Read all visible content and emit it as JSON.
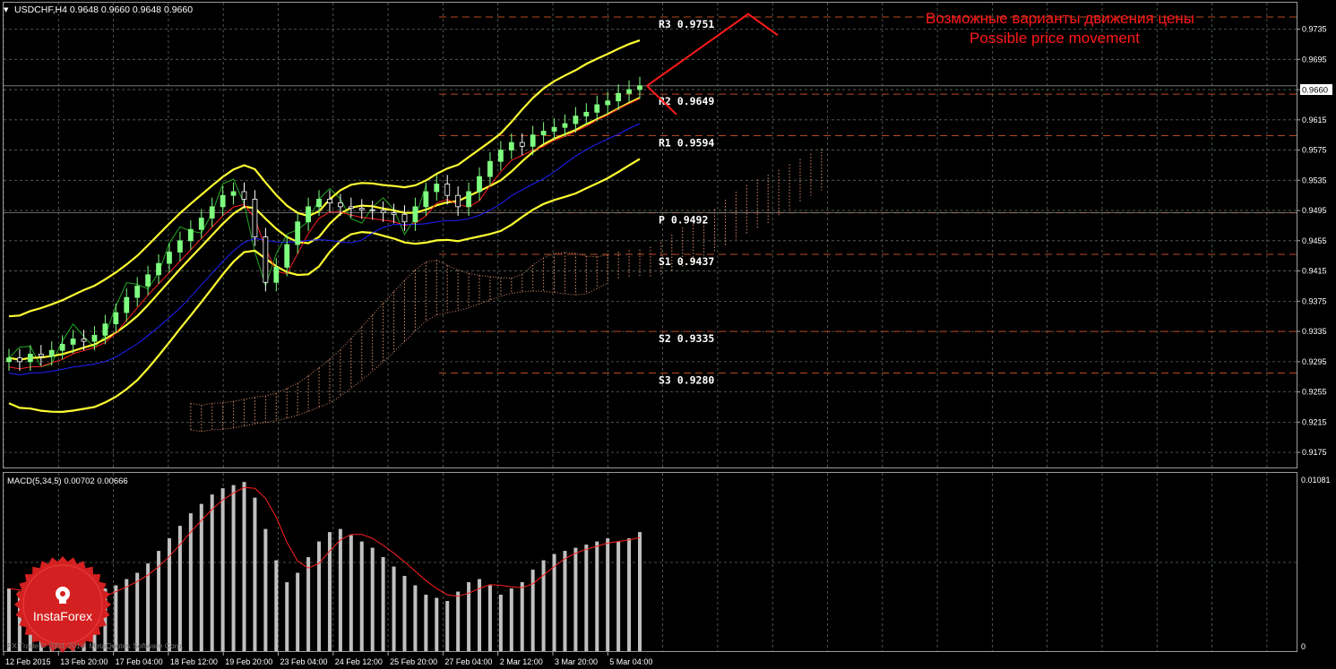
{
  "header": {
    "symbol_info": "USDCHF,H4  0.9648 0.9660 0.9648 0.9660"
  },
  "annotation": {
    "ru": "Возможные варианты движения цены",
    "en": "Possible price movement"
  },
  "brand": {
    "name": "InstaForex",
    "copyright": "FX Trade © 2001-2014, MetaQuotes Software Corp."
  },
  "macd_panel": {
    "label": "MACD(5,34,5) 0.00702 0.00666",
    "axis_top": "0.01081",
    "axis_zero": "0"
  },
  "colors": {
    "background": "#000000",
    "grid": "#5a6a5a",
    "bull_candle": "#7fff7f",
    "bear_candle": "#ffffff",
    "bollinger": "#ffff33",
    "tenkan": "#ff2020",
    "kijun": "#2020ff",
    "chikou": "#22aa22",
    "pivot_lines": "#b84a20",
    "annotation": "#ff1a1a",
    "macd_hist": "#c0c0c0",
    "macd_signal": "#ff2020"
  },
  "chart_data": {
    "type": "line",
    "symbol": "USDCHF",
    "timeframe": "H4",
    "current_price": "0.9660",
    "ylim": [
      0.9155,
      0.977
    ],
    "y_ticks": [
      "0.9735",
      "0.9695",
      "0.9655",
      "0.9615",
      "0.9575",
      "0.9535",
      "0.9495",
      "0.9455",
      "0.9415",
      "0.9375",
      "0.9335",
      "0.9295",
      "0.9255",
      "0.9215",
      "0.9175"
    ],
    "x_ticks": [
      "12 Feb 2015",
      "13 Feb 20:00",
      "17 Feb 04:00",
      "18 Feb 12:00",
      "19 Feb 20:00",
      "23 Feb 04:00",
      "24 Feb 12:00",
      "25 Feb 20:00",
      "27 Feb 04:00",
      "2 Mar 12:00",
      "3 Mar 20:00",
      "5 Mar 04:00"
    ],
    "pivot_levels": [
      {
        "name": "R3",
        "value": "0.9751"
      },
      {
        "name": "R2",
        "value": "0.9649"
      },
      {
        "name": "R1",
        "value": "0.9594"
      },
      {
        "name": "P",
        "value": "0.9492"
      },
      {
        "name": "S1",
        "value": "0.9437"
      },
      {
        "name": "S2",
        "value": "0.9335"
      },
      {
        "name": "S3",
        "value": "0.9280"
      }
    ],
    "close_series": [
      0.93,
      0.9295,
      0.9305,
      0.9302,
      0.931,
      0.9318,
      0.9325,
      0.9322,
      0.933,
      0.9345,
      0.936,
      0.938,
      0.9395,
      0.941,
      0.9425,
      0.944,
      0.9455,
      0.947,
      0.9485,
      0.95,
      0.9515,
      0.952,
      0.951,
      0.946,
      0.94,
      0.942,
      0.945,
      0.948,
      0.95,
      0.951,
      0.9505,
      0.95,
      0.9498,
      0.9496,
      0.9495,
      0.9492,
      0.949,
      0.948,
      0.95,
      0.952,
      0.953,
      0.9515,
      0.95,
      0.952,
      0.954,
      0.956,
      0.9575,
      0.9585,
      0.958,
      0.9595,
      0.96,
      0.9605,
      0.961,
      0.962,
      0.9625,
      0.9635,
      0.964,
      0.965,
      0.9655,
      0.966
    ],
    "macd_histogram": [
      0.004,
      0.0038,
      0.0036,
      0.003,
      0.0028,
      0.0026,
      0.003,
      0.0034,
      0.0036,
      0.004,
      0.0042,
      0.0046,
      0.005,
      0.0056,
      0.0064,
      0.0072,
      0.008,
      0.0088,
      0.0094,
      0.01,
      0.0104,
      0.0106,
      0.0108,
      0.0098,
      0.0078,
      0.0058,
      0.0044,
      0.005,
      0.006,
      0.007,
      0.0076,
      0.0078,
      0.0074,
      0.007,
      0.0066,
      0.006,
      0.0054,
      0.0048,
      0.0042,
      0.0036,
      0.0034,
      0.0032,
      0.0038,
      0.0044,
      0.0046,
      0.0042,
      0.0036,
      0.004,
      0.0044,
      0.0052,
      0.0058,
      0.0062,
      0.0064,
      0.0066,
      0.0068,
      0.007,
      0.0072,
      0.007,
      0.0072,
      0.0076
    ],
    "macd_ylim": [
      0,
      0.01081
    ]
  }
}
